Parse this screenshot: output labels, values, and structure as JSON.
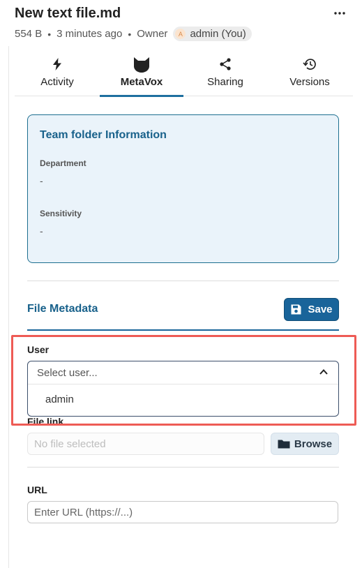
{
  "header": {
    "title": "New text file.md",
    "size": "554 B",
    "modified": "3 minutes ago",
    "owner_label": "Owner",
    "owner_initial": "A",
    "owner_name": "admin (You)"
  },
  "tabs": [
    {
      "label": "Activity",
      "icon": "lightning-icon",
      "active": false
    },
    {
      "label": "MetaVox",
      "icon": "cat-icon",
      "active": true
    },
    {
      "label": "Sharing",
      "icon": "share-icon",
      "active": false
    },
    {
      "label": "Versions",
      "icon": "history-icon",
      "active": false
    }
  ],
  "team_folder": {
    "title": "Team folder Information",
    "fields": [
      {
        "label": "Department",
        "value": "-"
      },
      {
        "label": "Sensitivity",
        "value": "-"
      }
    ]
  },
  "file_metadata": {
    "title": "File Metadata",
    "save_label": "Save",
    "user": {
      "label": "User",
      "placeholder": "Select user...",
      "options": [
        "admin"
      ]
    },
    "file_link": {
      "label": "File link",
      "placeholder": "No file selected",
      "browse_label": "Browse"
    },
    "url": {
      "label": "URL",
      "placeholder": "Enter URL (https://...)"
    }
  },
  "colors": {
    "accent": "#19649a",
    "team_box_bg": "#eaf3fa",
    "highlight": "#ee5b55"
  }
}
